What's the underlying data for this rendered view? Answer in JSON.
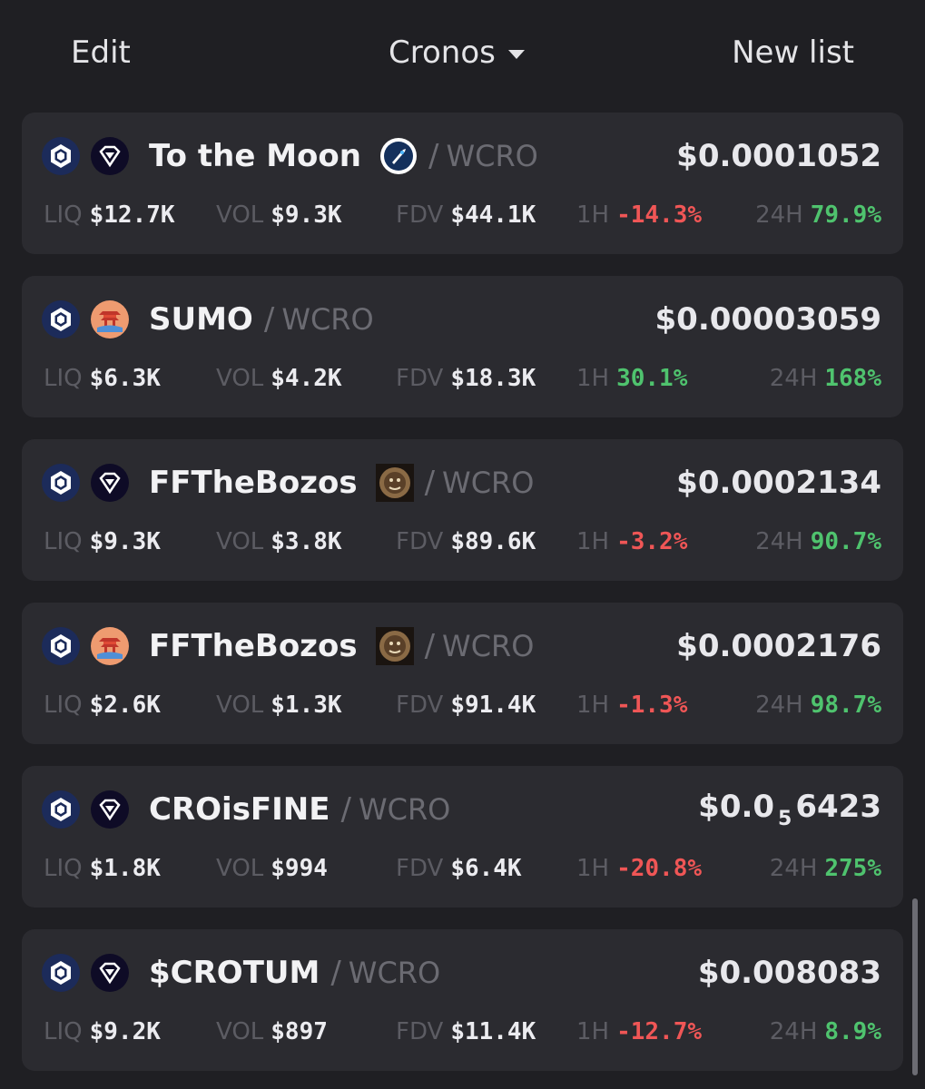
{
  "header": {
    "edit_label": "Edit",
    "chain_label": "Cronos",
    "new_list_label": "New list"
  },
  "colors": {
    "positive": "#4fc36e",
    "negative": "#f05656",
    "card_bg": "#2b2b30",
    "page_bg": "#1f1f23"
  },
  "labels": {
    "liq": "LIQ",
    "vol": "VOL",
    "fdv": "FDV",
    "h1": "1H",
    "h24": "24H",
    "sep": "/"
  },
  "pairs": [
    {
      "chain_icon": "cronos-icon",
      "dex_icon": "vvs-finance-icon",
      "name": "To the Moon",
      "token_icon": "rocket-token-icon",
      "quote": "WCRO",
      "price": "$0.0001052",
      "liq": "$12.7K",
      "vol": "$9.3K",
      "fdv": "$44.1K",
      "change_1h": "-14.3%",
      "change_24h": "79.9%"
    },
    {
      "chain_icon": "cronos-icon",
      "dex_icon": "temple-dex-icon",
      "name": "SUMO",
      "quote": "WCRO",
      "price": "$0.00003059",
      "liq": "$6.3K",
      "vol": "$4.2K",
      "fdv": "$18.3K",
      "change_1h": "30.1%",
      "change_24h": "168%"
    },
    {
      "chain_icon": "cronos-icon",
      "dex_icon": "vvs-finance-icon",
      "name": "FFTheBozos",
      "token_icon": "bozo-token-icon",
      "quote": "WCRO",
      "price": "$0.0002134",
      "liq": "$9.3K",
      "vol": "$3.8K",
      "fdv": "$89.6K",
      "change_1h": "-3.2%",
      "change_24h": "90.7%"
    },
    {
      "chain_icon": "cronos-icon",
      "dex_icon": "temple-dex-icon",
      "name": "FFTheBozos",
      "token_icon": "bozo-token-icon",
      "quote": "WCRO",
      "price": "$0.0002176",
      "liq": "$2.6K",
      "vol": "$1.3K",
      "fdv": "$91.4K",
      "change_1h": "-1.3%",
      "change_24h": "98.7%"
    },
    {
      "chain_icon": "cronos-icon",
      "dex_icon": "vvs-finance-icon",
      "name": "CROisFINE",
      "quote": "WCRO",
      "price_prefix": "$0.0",
      "price_zeros": "5",
      "price_suffix": "6423",
      "liq": "$1.8K",
      "vol": "$994",
      "fdv": "$6.4K",
      "change_1h": "-20.8%",
      "change_24h": "275%"
    },
    {
      "chain_icon": "cronos-icon",
      "dex_icon": "vvs-finance-icon",
      "name": "$CROTUM",
      "quote": "WCRO",
      "price": "$0.008083",
      "liq": "$9.2K",
      "vol": "$897",
      "fdv": "$11.4K",
      "change_1h": "-12.7%",
      "change_24h": "8.9%"
    }
  ]
}
